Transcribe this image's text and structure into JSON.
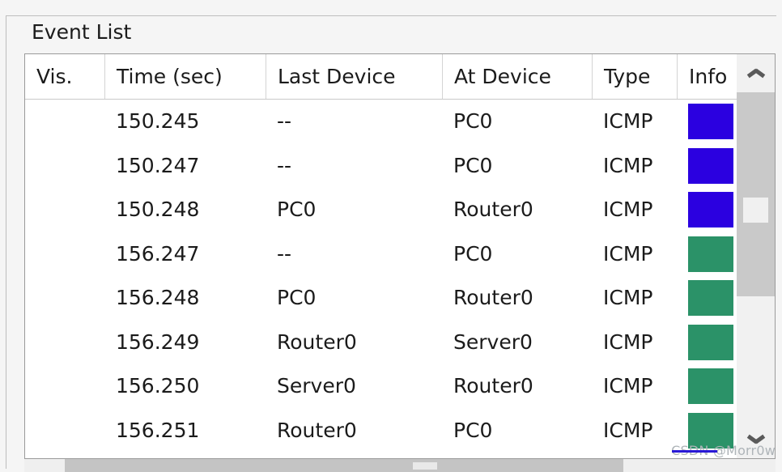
{
  "group": {
    "legend": "Event List"
  },
  "table": {
    "columns": [
      {
        "key": "vis",
        "label": "Vis."
      },
      {
        "key": "time",
        "label": "Time (sec)"
      },
      {
        "key": "last",
        "label": "Last Device"
      },
      {
        "key": "at",
        "label": "At Device"
      },
      {
        "key": "type",
        "label": "Type"
      },
      {
        "key": "info",
        "label": "Info"
      }
    ],
    "rows": [
      {
        "vis": "",
        "time": "150.245",
        "last": "--",
        "at": "PC0",
        "type": "ICMP",
        "info_color": "#2b00e0"
      },
      {
        "vis": "",
        "time": "150.247",
        "last": "--",
        "at": "PC0",
        "type": "ICMP",
        "info_color": "#2b00e0"
      },
      {
        "vis": "",
        "time": "150.248",
        "last": "PC0",
        "at": "Router0",
        "type": "ICMP",
        "info_color": "#2b00e0"
      },
      {
        "vis": "",
        "time": "156.247",
        "last": "--",
        "at": "PC0",
        "type": "ICMP",
        "info_color": "#2b9268"
      },
      {
        "vis": "",
        "time": "156.248",
        "last": "PC0",
        "at": "Router0",
        "type": "ICMP",
        "info_color": "#2b9268"
      },
      {
        "vis": "",
        "time": "156.249",
        "last": "Router0",
        "at": "Server0",
        "type": "ICMP",
        "info_color": "#2b9268"
      },
      {
        "vis": "",
        "time": "156.250",
        "last": "Server0",
        "at": "Router0",
        "type": "ICMP",
        "info_color": "#2b9268"
      },
      {
        "vis": "",
        "time": "156.251",
        "last": "Router0",
        "at": "PC0",
        "type": "ICMP",
        "info_color": "#2b9268"
      }
    ]
  },
  "scrollbars": {
    "vertical": {
      "up_icon": "chevron-up-icon",
      "down_icon": "chevron-down-icon"
    },
    "horizontal": {}
  },
  "watermark": {
    "text": "CSDN @Morr0w"
  },
  "colors": {
    "info_blue": "#2b00e0",
    "info_green": "#2b9268",
    "panel_background": "#f5f5f5",
    "table_background": "#ffffff",
    "border": "#9a9a9a"
  }
}
